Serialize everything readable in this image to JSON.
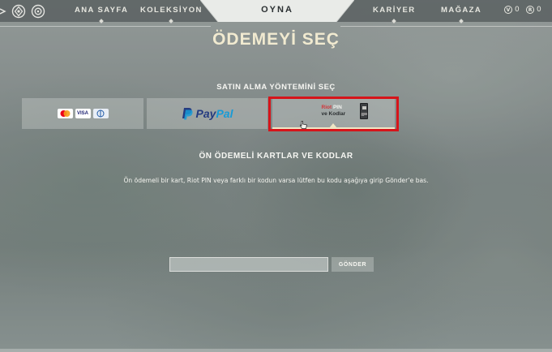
{
  "nav": {
    "items": [
      {
        "label": "ANA SAYFA"
      },
      {
        "label": "KOLEKSİYON"
      },
      {
        "label": "OYNA"
      },
      {
        "label": "KARİYER"
      },
      {
        "label": "MAĞAZA"
      }
    ],
    "currency": [
      {
        "icon": "valorant-points-icon",
        "value": "0"
      },
      {
        "icon": "radianite-points-icon",
        "value": "0"
      }
    ]
  },
  "page": {
    "title": "ÖDEMEYİ SEÇ",
    "method_label": "SATIN ALMA YÖNTEMİNİ SEÇ",
    "payment_methods": [
      {
        "name": "cards",
        "logos": [
          "mastercard",
          "VISA",
          "diners"
        ]
      },
      {
        "name": "paypal",
        "label_pay": "Pay",
        "label_pal": "Pal"
      },
      {
        "name": "riot-pin",
        "line1_a": "Riot",
        "line1_b": "PIN",
        "line2": "ve Kodlar",
        "selected": true
      }
    ],
    "section_title": "ÖN ÖDEMELİ KARTLAR VE KODLAR",
    "description": "Ön ödemeli bir kart, Riot PIN veya farklı bir kodun varsa lütfen bu kodu aşağıya girip Gönder’e bas.",
    "code_input": {
      "value": "",
      "placeholder": ""
    },
    "submit_label": "GÖNDER"
  },
  "colors": {
    "accent": "#f1ead0",
    "highlight": "#d6141a",
    "riot_red": "#d13639",
    "paypal_dark": "#253b80",
    "paypal_light": "#179bd7"
  }
}
